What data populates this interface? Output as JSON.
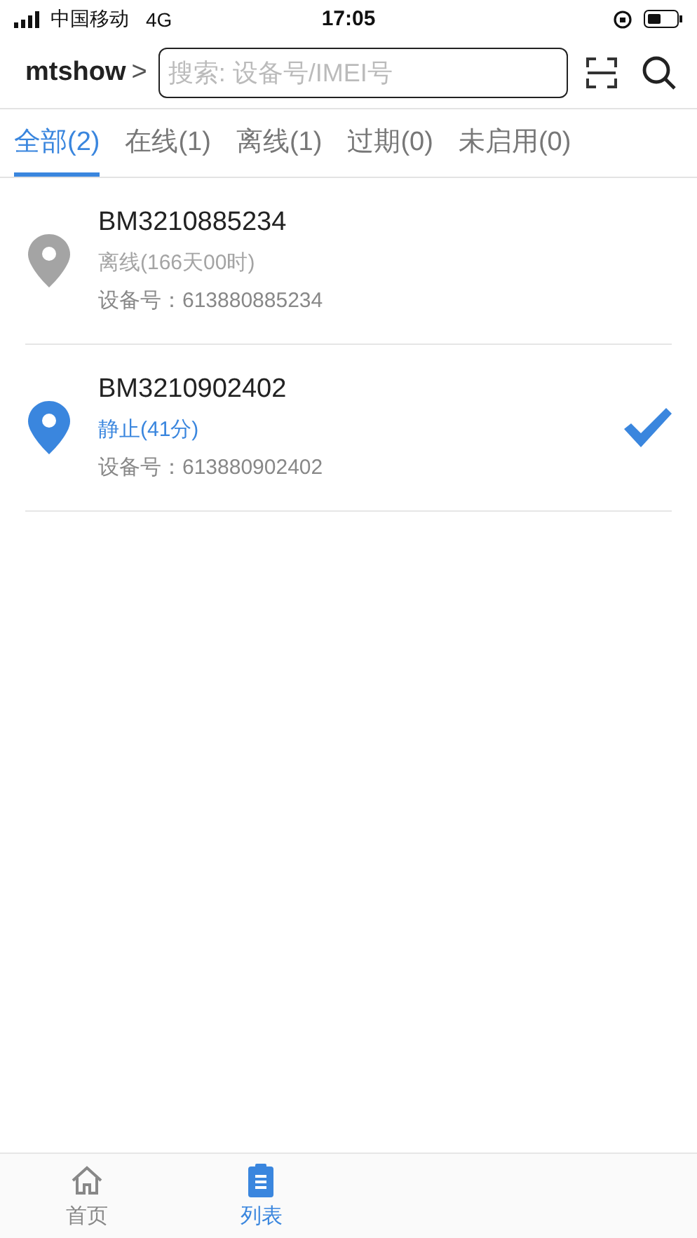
{
  "status_bar": {
    "carrier": "中国移动",
    "network": "4G",
    "time": "17:05"
  },
  "header": {
    "account": "mtshow",
    "chevron": ">",
    "search": {
      "placeholder": "搜索: 设备号/IMEI号"
    }
  },
  "tabs": [
    {
      "label": "全部(2)",
      "selected": true
    },
    {
      "label": "在线(1)",
      "selected": false
    },
    {
      "label": "离线(1)",
      "selected": false
    },
    {
      "label": "过期(0)",
      "selected": false
    },
    {
      "label": "未启用(0)",
      "selected": false
    }
  ],
  "devices": [
    {
      "name": "BM3210885234",
      "kind": "offline",
      "status": "离线(166天00时)",
      "id_label": "设备号：613880885234",
      "selected": false
    },
    {
      "name": "BM3210902402",
      "kind": "static",
      "status": "静止(41分)",
      "id_label": "设备号：613880902402",
      "selected": true
    }
  ],
  "bottom_nav": [
    {
      "kind": "home",
      "label": "首页",
      "selected": false
    },
    {
      "kind": "list",
      "label": "列表",
      "selected": true
    }
  ]
}
